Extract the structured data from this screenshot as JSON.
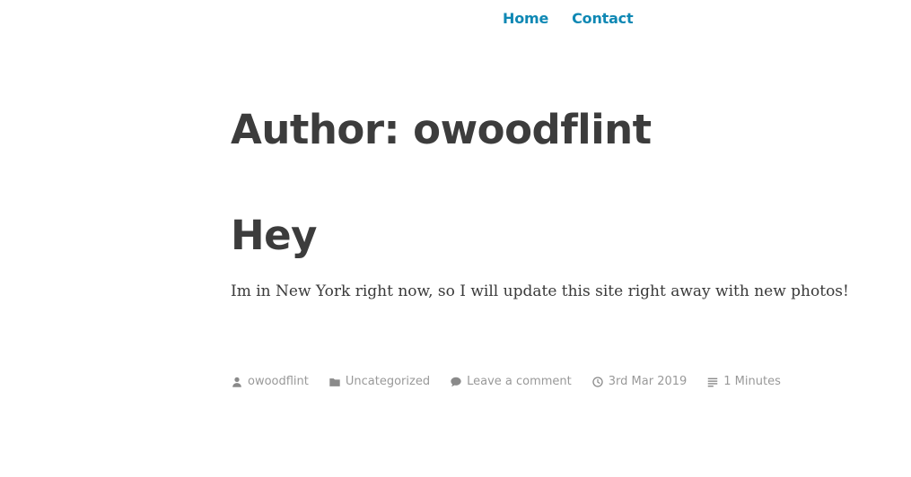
{
  "nav": {
    "items": [
      {
        "label": "Home"
      },
      {
        "label": "Contact"
      }
    ]
  },
  "archive": {
    "title": "Author: owoodflint"
  },
  "post": {
    "title": "Hey",
    "excerpt": "Im in New York right now, so I will update this site right away with new photos!",
    "meta": {
      "author": "owoodflint",
      "category": "Uncategorized",
      "comments": "Leave a comment",
      "date": "3rd Mar 2019",
      "reading_time": "1 Minutes"
    }
  },
  "icons": {
    "author": "person-icon",
    "category": "folder-icon",
    "comments": "comment-bubble-icon",
    "date": "clock-icon",
    "reading_time": "lines-icon"
  },
  "colors": {
    "link": "#0f88b4",
    "text": "#3c3c3c",
    "meta": "#999999"
  }
}
